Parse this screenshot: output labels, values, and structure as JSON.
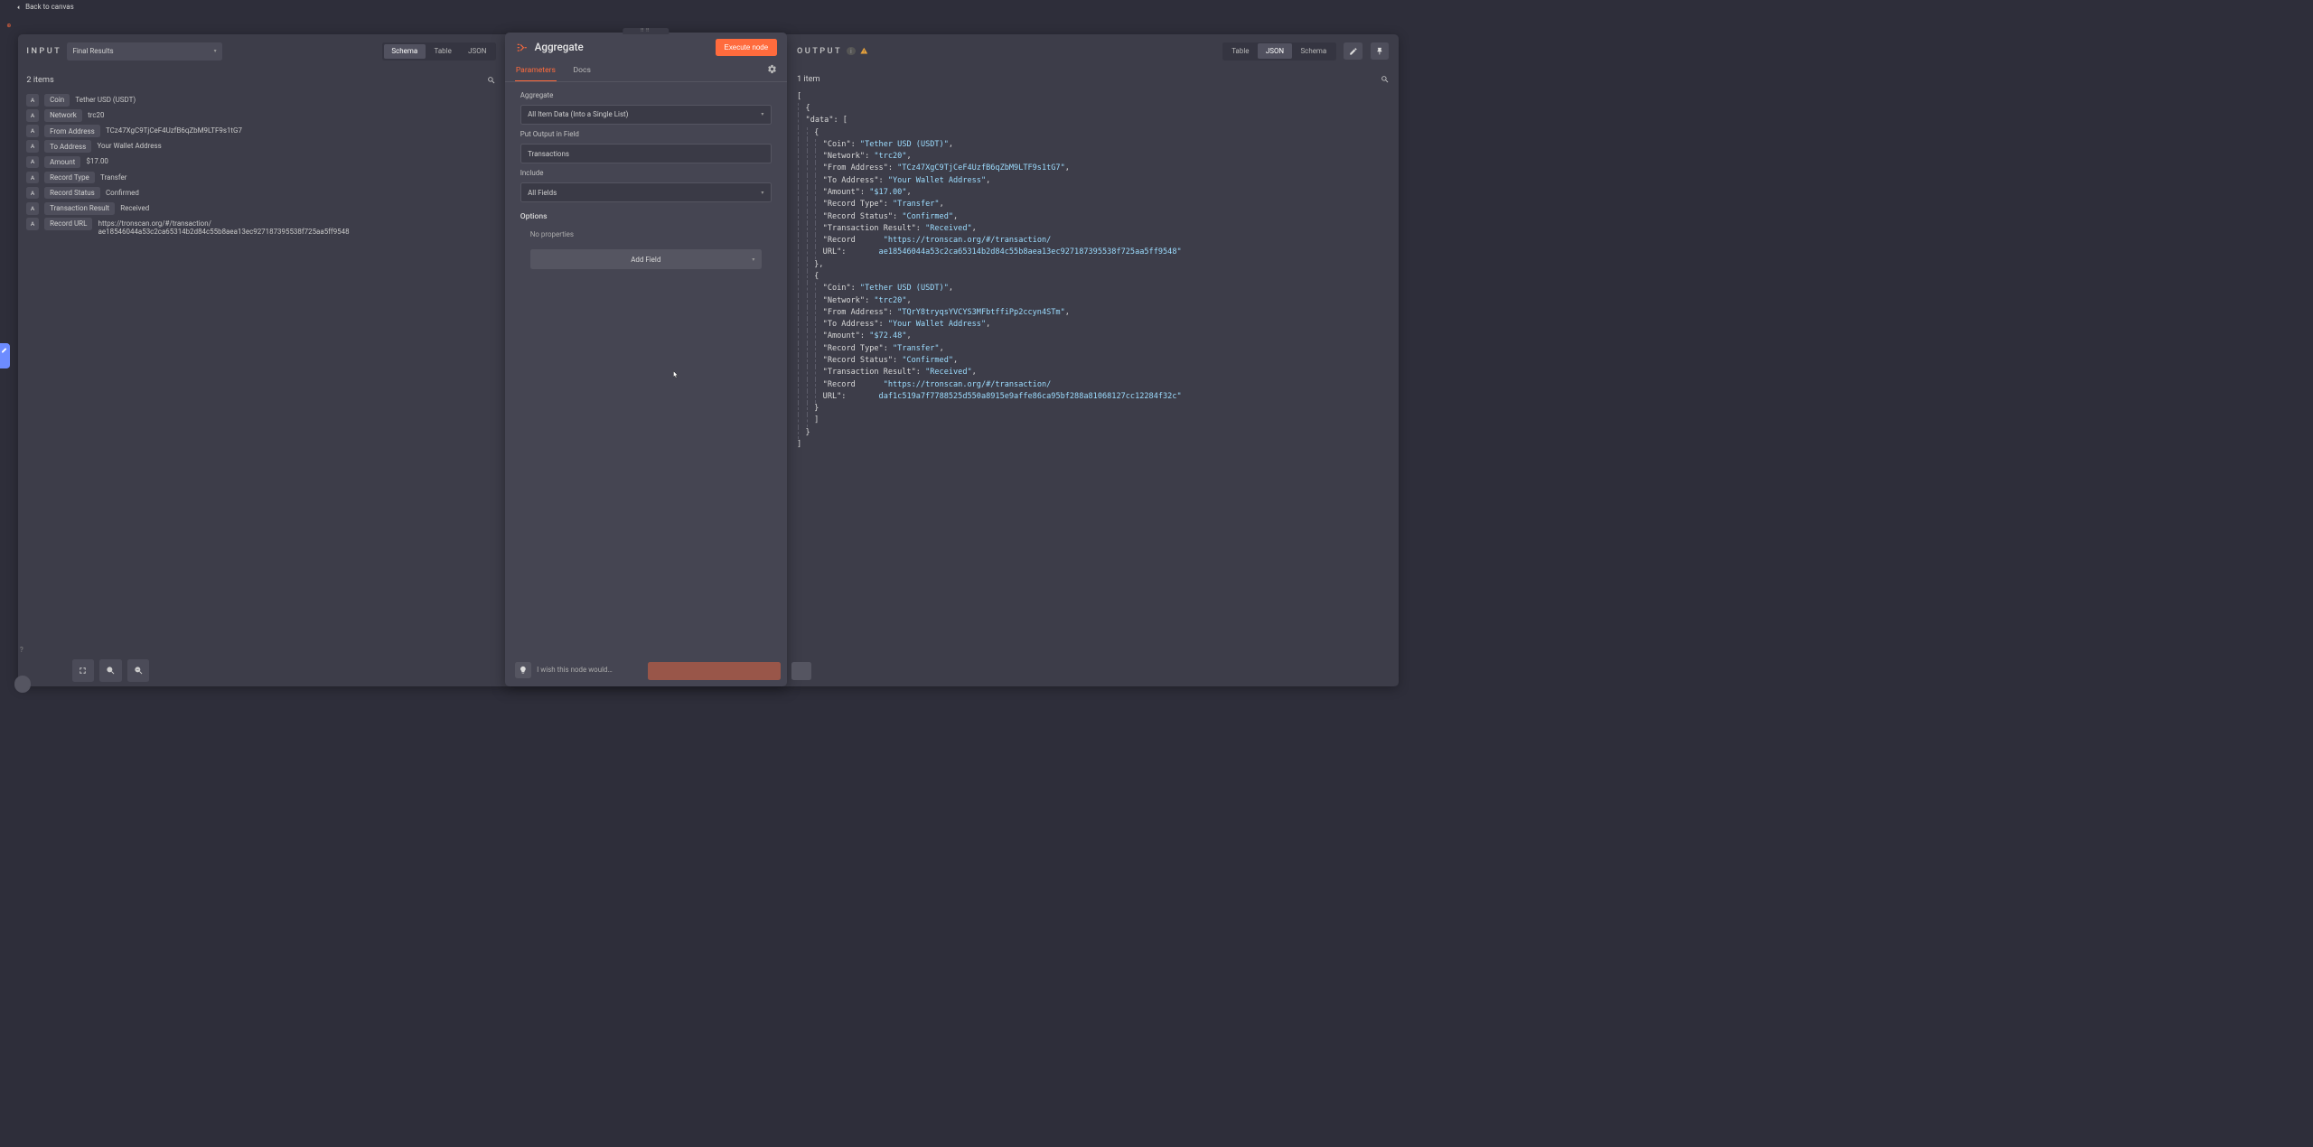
{
  "topbar": {
    "back_label": "Back to canvas"
  },
  "input": {
    "heading": "INPUT",
    "source": "Final Results",
    "tabs": {
      "schema": "Schema",
      "table": "Table",
      "json": "JSON"
    },
    "items_count": "2 items",
    "schema": [
      {
        "key": "Coin",
        "val": "Tether USD (USDT)"
      },
      {
        "key": "Network",
        "val": "trc20"
      },
      {
        "key": "From Address",
        "val": "TCz47XgC9TjCeF4UzfB6qZbM9LTF9s1tG7"
      },
      {
        "key": "To Address",
        "val": "Your Wallet Address"
      },
      {
        "key": "Amount",
        "val": "$17.00"
      },
      {
        "key": "Record Type",
        "val": "Transfer"
      },
      {
        "key": "Record Status",
        "val": "Confirmed"
      },
      {
        "key": "Transaction Result",
        "val": "Received"
      },
      {
        "key": "Record URL",
        "val": "https://tronscan.org/#/transaction/ ae18546044a53c2ca65314b2d84c55b8aea13ec927187395538f725aa5ff9548"
      }
    ]
  },
  "node": {
    "title": "Aggregate",
    "execute_label": "Execute node",
    "tabs": {
      "params": "Parameters",
      "docs": "Docs"
    },
    "params": {
      "aggregate_label": "Aggregate",
      "aggregate_value": "All Item Data (Into a Single List)",
      "put_output_label": "Put Output in Field",
      "put_output_value": "Transactions",
      "include_label": "Include",
      "include_value": "All Fields",
      "options_label": "Options",
      "no_props": "No properties",
      "add_field": "Add Field"
    },
    "wish": "I wish this node would…"
  },
  "output": {
    "heading": "OUTPUT",
    "tabs": {
      "table": "Table",
      "json": "JSON",
      "schema": "Schema"
    },
    "items_count": "1 item",
    "data": [
      {
        "Coin": "Tether USD (USDT)",
        "Network": "trc20",
        "From Address": "TCz47XgC9TjCeF4UzfB6qZbM9LTF9s1tG7",
        "To Address": "Your Wallet Address",
        "Amount": "$17.00",
        "Record Type": "Transfer",
        "Record Status": "Confirmed",
        "Transaction Result": "Received",
        "Record URL": "https://tronscan.org/#/transaction/ae18546044a53c2ca65314b2d84c55b8aea13ec927187395538f725aa5ff9548"
      },
      {
        "Coin": "Tether USD (USDT)",
        "Network": "trc20",
        "From Address": "TQrY8tryqsYVCYS3MFbtffiPp2ccyn4STm",
        "To Address": "Your Wallet Address",
        "Amount": "$72.48",
        "Record Type": "Transfer",
        "Record Status": "Confirmed",
        "Transaction Result": "Received",
        "Record URL": "https://tronscan.org/#/transaction/daf1c519a7f7788525d550a8915e9affe86ca95bf288a81068127cc12284f32c"
      }
    ]
  }
}
